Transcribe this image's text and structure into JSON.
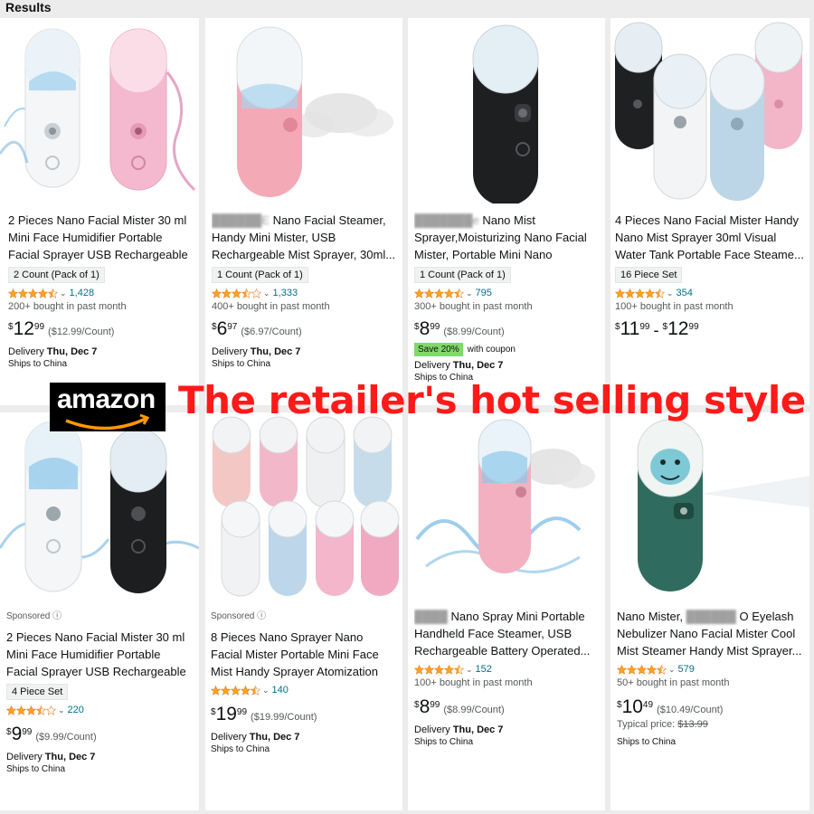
{
  "header": {
    "title": "Results"
  },
  "overlay": {
    "logo_text": "amazon",
    "banner": "The retailer's hot selling style"
  },
  "colors": {
    "star": "#ffa41c",
    "link": "#007185",
    "save_badge": "#7fda69",
    "overlay_text": "#ff1a1a"
  },
  "products": [
    {
      "title": "2 Pieces Nano Facial Mister 30 ml Mini Face Humidifier Portable Facial Sprayer USB Rechargeable Handy...",
      "variant": "2 Count (Pack of 1)",
      "rating": 4.5,
      "reviews": "1,428",
      "bought": "200+ bought in past month",
      "price_whole": "12",
      "price_frac": "99",
      "unit_price": "($12.99/Count)",
      "delivery_label": "Delivery",
      "delivery_date": "Thu, Dec 7",
      "ships": "Ships to China",
      "image": "white-and-pink-mister"
    },
    {
      "title_blur": "██████E",
      "title": "Nano Facial Steamer, Handy Mini Mister, USB Rechargeable Mist Sprayer, 30ml...",
      "variant": "1 Count (Pack of 1)",
      "rating": 3.5,
      "reviews": "1,333",
      "bought": "400+ bought in past month",
      "price_whole": "6",
      "price_frac": "97",
      "unit_price": "($6.97/Count)",
      "delivery_label": "Delivery",
      "delivery_date": "Thu, Dec 7",
      "ships": "Ships to China",
      "image": "pink-mister-spraying"
    },
    {
      "title_blur": "███████e",
      "title": "Nano Mist Sprayer,Moisturizing Nano Facial Mister, Portable Mini Nano Mister,...",
      "variant": "1 Count (Pack of 1)",
      "rating": 4.5,
      "reviews": "795",
      "bought": "300+ bought in past month",
      "price_whole": "8",
      "price_frac": "99",
      "unit_price": "($8.99/Count)",
      "save": "Save 20%",
      "coupon": "with coupon",
      "delivery_label": "Delivery",
      "delivery_date": "Thu, Dec 7",
      "ships": "Ships to China",
      "image": "black-mister"
    },
    {
      "title": "4 Pieces Nano Facial Mister Handy Nano Mist Sprayer 30ml Visual Water Tank Portable Face Steame...",
      "variant": "16 Piece Set",
      "rating": 4.5,
      "reviews": "354",
      "bought": "100+ bought in past month",
      "price_whole": "11",
      "price_frac": "99",
      "price_dash": "-",
      "price2_whole": "12",
      "price2_frac": "99",
      "image": "four-color-misters"
    },
    {
      "sponsored": "Sponsored",
      "title": "2 Pieces Nano Facial Mister 30 ml Mini Face Humidifier Portable Facial Sprayer USB Rechargeable Handy...",
      "variant": "4 Piece Set",
      "rating": 3.5,
      "reviews": "220",
      "price_whole": "9",
      "price_frac": "99",
      "unit_price": "($9.99/Count)",
      "delivery_label": "Delivery",
      "delivery_date": "Thu, Dec 7",
      "ships": "Ships to China",
      "image": "white-and-black-mister"
    },
    {
      "sponsored": "Sponsored",
      "title": "8 Pieces Nano Sprayer Nano Facial Mister Portable Mini Face Mist Handy Sprayer Atomization USB...",
      "rating": 4.5,
      "reviews": "140",
      "price_whole": "19",
      "price_frac": "99",
      "unit_price": "($19.99/Count)",
      "delivery_label": "Delivery",
      "delivery_date": "Thu, Dec 7",
      "ships": "Ships to China",
      "image": "eight-misters"
    },
    {
      "title_blur": "████",
      "title": "Nano Spray Mini Portable Handheld Face Steamer, USB Rechargeable Battery Operated...",
      "rating": 4.5,
      "reviews": "152",
      "bought": "100+ bought in past month",
      "price_whole": "8",
      "price_frac": "99",
      "unit_price": "($8.99/Count)",
      "delivery_label": "Delivery",
      "delivery_date": "Thu, Dec 7",
      "ships": "Ships to China",
      "image": "pink-mister-splash"
    },
    {
      "title_pre": "Nano Mister,",
      "title_blur": "██████",
      "title": "O Eyelash Nebulizer Nano Facial Mister Cool Mist Steamer Handy Mist Sprayer...",
      "rating": 4.5,
      "reviews": "579",
      "bought": "50+ bought in past month",
      "price_whole": "10",
      "price_frac": "49",
      "unit_price": "($10.49/Count)",
      "typical_label": "Typical price:",
      "typical_price": "$13.99",
      "ships": "Ships to China",
      "image": "green-dino-mister"
    }
  ]
}
